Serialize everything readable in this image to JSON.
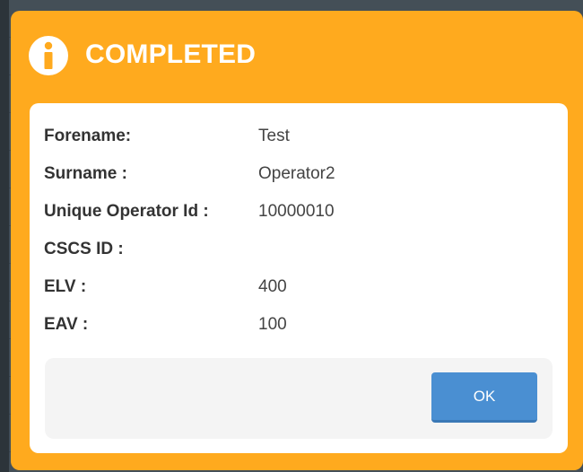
{
  "dialog": {
    "title": "COMPLETED",
    "icon": "info-icon",
    "header_color": "#ffaa1e",
    "fields": [
      {
        "label": "Forename:",
        "value": "Test"
      },
      {
        "label": "Surname :",
        "value": "Operator2"
      },
      {
        "label": "Unique Operator Id :",
        "value": "10000010"
      },
      {
        "label": "CSCS ID :",
        "value": ""
      },
      {
        "label": "ELV :",
        "value": "400"
      },
      {
        "label": "EAV :",
        "value": "100"
      }
    ],
    "ok_label": "OK",
    "ok_color": "#4a8fd2"
  }
}
